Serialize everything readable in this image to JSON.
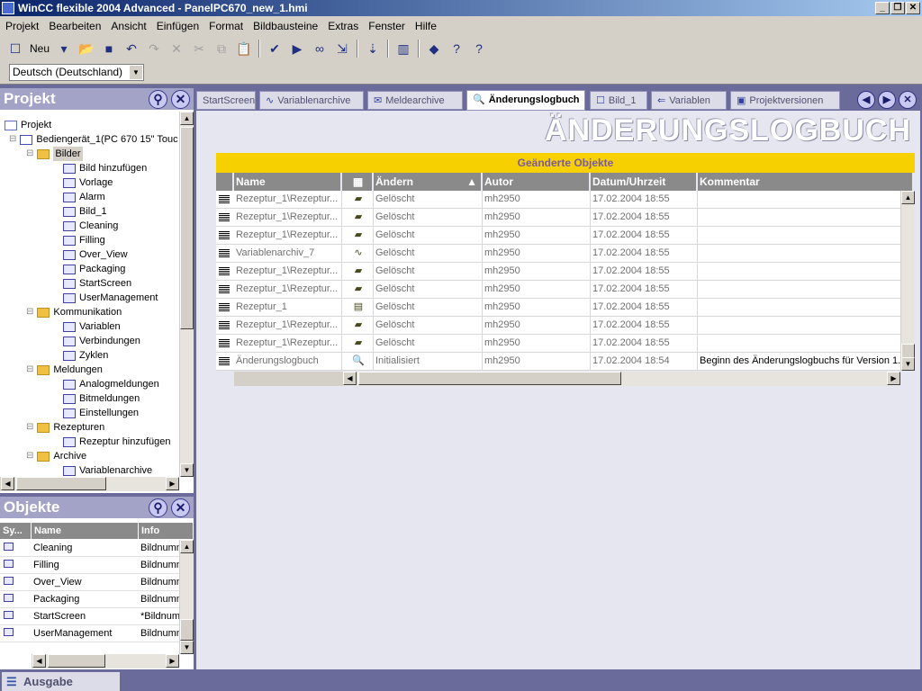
{
  "window": {
    "title": "WinCC flexible 2004 Advanced - PanelPC670_new_1.hmi"
  },
  "menu": [
    "Projekt",
    "Bearbeiten",
    "Ansicht",
    "Einfügen",
    "Format",
    "Bildbausteine",
    "Extras",
    "Fenster",
    "Hilfe"
  ],
  "toolbar": {
    "new_label": "Neu"
  },
  "language": {
    "selected": "Deutsch (Deutschland)"
  },
  "project_panel": {
    "title": "Projekt",
    "tree": [
      {
        "label": "Projekt",
        "level": 0
      },
      {
        "label": "Bediengerät_1(PC 670 15\" Touc",
        "level": 1
      },
      {
        "label": "Bilder",
        "level": 2,
        "selected": true
      },
      {
        "label": "Bild hinzufügen",
        "level": 3
      },
      {
        "label": "Vorlage",
        "level": 3
      },
      {
        "label": "Alarm",
        "level": 3
      },
      {
        "label": "Bild_1",
        "level": 3
      },
      {
        "label": "Cleaning",
        "level": 3
      },
      {
        "label": "Filling",
        "level": 3
      },
      {
        "label": "Over_View",
        "level": 3
      },
      {
        "label": "Packaging",
        "level": 3
      },
      {
        "label": "StartScreen",
        "level": 3
      },
      {
        "label": "UserManagement",
        "level": 3
      },
      {
        "label": "Kommunikation",
        "level": 2
      },
      {
        "label": "Variablen",
        "level": 3
      },
      {
        "label": "Verbindungen",
        "level": 3
      },
      {
        "label": "Zyklen",
        "level": 3
      },
      {
        "label": "Meldungen",
        "level": 2
      },
      {
        "label": "Analogmeldungen",
        "level": 3
      },
      {
        "label": "Bitmeldungen",
        "level": 3
      },
      {
        "label": "Einstellungen",
        "level": 3
      },
      {
        "label": "Rezepturen",
        "level": 2
      },
      {
        "label": "Rezeptur hinzufügen",
        "level": 3
      },
      {
        "label": "Archive",
        "level": 2
      },
      {
        "label": "Variablenarchive",
        "level": 3
      },
      {
        "label": "Meldearchive",
        "level": 3
      }
    ]
  },
  "objects_panel": {
    "title": "Objekte",
    "columns": [
      "Sy...",
      "Name",
      "Info"
    ],
    "rows": [
      {
        "name": "Cleaning",
        "info": "Bildnumm"
      },
      {
        "name": "Filling",
        "info": "Bildnumm"
      },
      {
        "name": "Over_View",
        "info": "Bildnumm"
      },
      {
        "name": "Packaging",
        "info": "Bildnumm"
      },
      {
        "name": "StartScreen",
        "info": "*Bildnum"
      },
      {
        "name": "UserManagement",
        "info": "Bildnumm"
      }
    ]
  },
  "tabs": [
    {
      "label": "StartScreen"
    },
    {
      "label": "Variablenarchive"
    },
    {
      "label": "Meldearchive"
    },
    {
      "label": "Änderungslogbuch",
      "active": true
    },
    {
      "label": "Bild_1"
    },
    {
      "label": "Variablen"
    },
    {
      "label": "Projektversionen"
    }
  ],
  "main": {
    "heading": "ÄNDERUNGSLOGBUCH",
    "table_title": "Geänderte Objekte",
    "columns": [
      "Name",
      "",
      "Ändern",
      "Autor",
      "Datum/Uhrzeit",
      "Kommentar"
    ],
    "rows": [
      {
        "name": "Rezeptur_1\\Rezeptur...",
        "icon": "recipe-icon",
        "change": "Gelöscht",
        "author": "mh2950",
        "date": "17.02.2004 18:55",
        "comment": ""
      },
      {
        "name": "Rezeptur_1\\Rezeptur...",
        "icon": "recipe-icon",
        "change": "Gelöscht",
        "author": "mh2950",
        "date": "17.02.2004 18:55",
        "comment": ""
      },
      {
        "name": "Rezeptur_1\\Rezeptur...",
        "icon": "recipe-icon",
        "change": "Gelöscht",
        "author": "mh2950",
        "date": "17.02.2004 18:55",
        "comment": ""
      },
      {
        "name": "Variablenarchiv_7",
        "icon": "tag-archive-icon",
        "change": "Gelöscht",
        "author": "mh2950",
        "date": "17.02.2004 18:55",
        "comment": ""
      },
      {
        "name": "Rezeptur_1\\Rezeptur...",
        "icon": "recipe-icon",
        "change": "Gelöscht",
        "author": "mh2950",
        "date": "17.02.2004 18:55",
        "comment": ""
      },
      {
        "name": "Rezeptur_1\\Rezeptur...",
        "icon": "recipe-icon",
        "change": "Gelöscht",
        "author": "mh2950",
        "date": "17.02.2004 18:55",
        "comment": ""
      },
      {
        "name": "Rezeptur_1",
        "icon": "recipe-doc-icon",
        "change": "Gelöscht",
        "author": "mh2950",
        "date": "17.02.2004 18:55",
        "comment": ""
      },
      {
        "name": "Rezeptur_1\\Rezeptur...",
        "icon": "recipe-icon",
        "change": "Gelöscht",
        "author": "mh2950",
        "date": "17.02.2004 18:55",
        "comment": ""
      },
      {
        "name": "Rezeptur_1\\Rezeptur...",
        "icon": "recipe-icon",
        "change": "Gelöscht",
        "author": "mh2950",
        "date": "17.02.2004 18:55",
        "comment": ""
      },
      {
        "name": "Änderungslogbuch",
        "icon": "change-log-icon",
        "change": "Initialisiert",
        "author": "mh2950",
        "date": "17.02.2004 18:54",
        "comment": "Beginn des Änderungslogbuchs für Version 1."
      }
    ]
  },
  "output": {
    "label": "Ausgabe"
  },
  "colors": {
    "panel_bg": "#6b6b9b",
    "header_yellow": "#f7d000",
    "title_text": "#7a5aa0"
  }
}
